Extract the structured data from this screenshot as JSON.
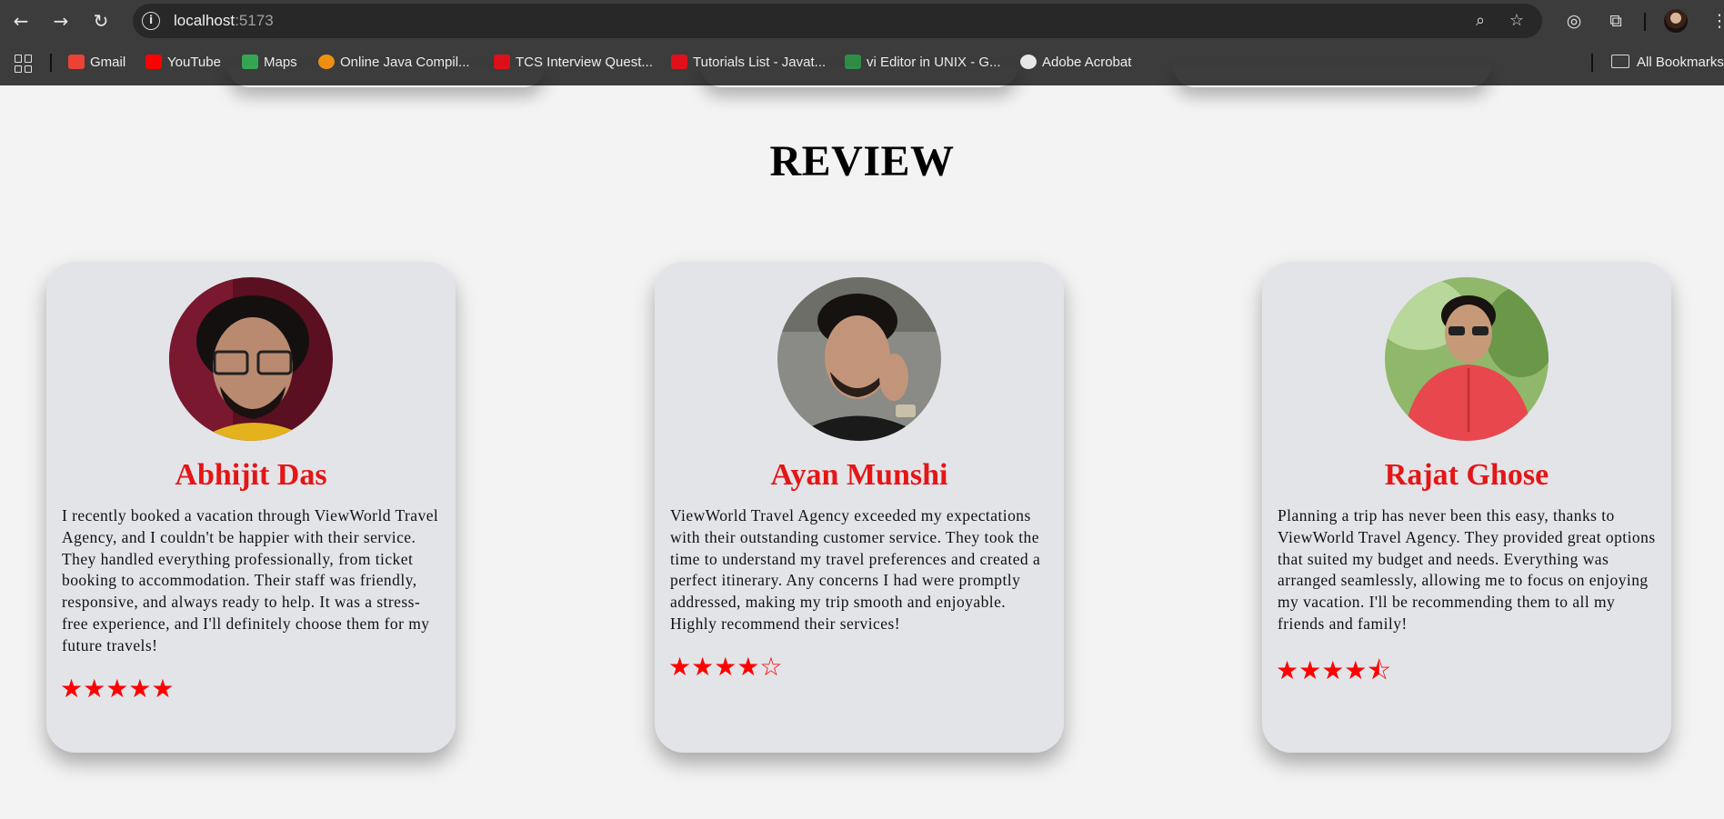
{
  "browser": {
    "url_host": "localhost",
    "url_port": ":5173",
    "bookmarks": [
      {
        "label": "Gmail",
        "color": "#ea4335"
      },
      {
        "label": "YouTube",
        "color": "#ff0000"
      },
      {
        "label": "Maps",
        "color": "#34a853"
      },
      {
        "label": "Online Java Compil...",
        "color": "#f29111"
      },
      {
        "label": "TCS Interview Quest...",
        "color": "#e0101a"
      },
      {
        "label": "Tutorials List - Javat...",
        "color": "#e0101a"
      },
      {
        "label": "vi Editor in UNIX - G...",
        "color": "#2f8d46"
      },
      {
        "label": "Adobe Acrobat",
        "color": "#e8e8e8"
      }
    ],
    "all_bookmarks": "All Bookmarks"
  },
  "page": {
    "title": "REVIEW",
    "accent_color": "#e41616",
    "reviews": [
      {
        "name": "Abhijit Das",
        "text": "I recently booked a vacation through ViewWorld Travel Agency, and I couldn't be happier with their service. They handled everything professionally, from ticket booking to accommodation. Their staff was friendly, responsive, and always ready to help. It was a stress-free experience, and I'll definitely choose them for my future travels!",
        "stars": "★★★★★",
        "rating": 5
      },
      {
        "name": "Ayan Munshi",
        "text": "ViewWorld Travel Agency exceeded my expectations with their outstanding customer service. They took the time to understand my travel preferences and created a perfect itinerary. Any concerns I had were promptly addressed, making my trip smooth and enjoyable. Highly recommend their services!",
        "stars": "★★★★☆",
        "rating": 4
      },
      {
        "name": "Rajat Ghose",
        "text": "Planning a trip has never been this easy, thanks to ViewWorld Travel Agency. They provided great options that suited my budget and needs. Everything was arranged seamlessly, allowing me to focus on enjoying my vacation. I'll be recommending them to all my friends and family!",
        "stars": "★★★★⯪",
        "rating": 4.5
      }
    ]
  }
}
